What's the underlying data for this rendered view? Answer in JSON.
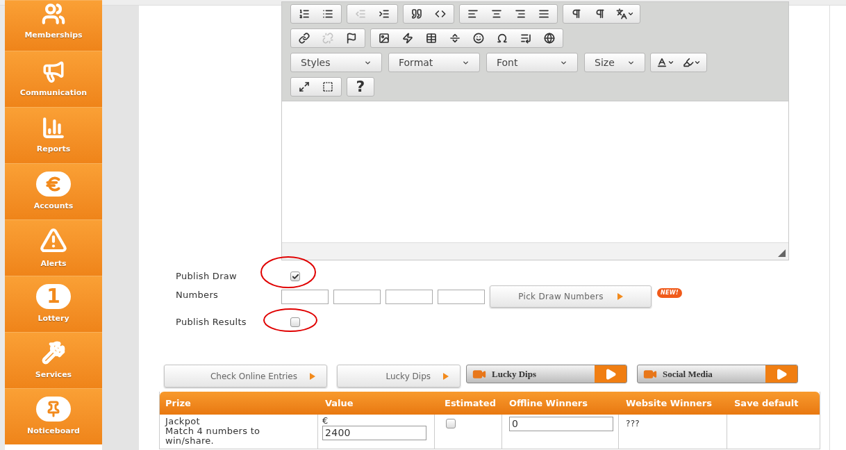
{
  "sidebar": {
    "items": [
      {
        "label": "Memberships",
        "kind": "people"
      },
      {
        "label": "Communication",
        "kind": "megaphone"
      },
      {
        "label": "Reports",
        "kind": "chart"
      },
      {
        "label": "Accounts",
        "kind": "euro"
      },
      {
        "label": "Alerts",
        "kind": "alert"
      },
      {
        "label": "Lottery",
        "kind": "number",
        "badge": "1"
      },
      {
        "label": "Services",
        "kind": "tools"
      },
      {
        "label": "Noticeboard",
        "kind": "pin"
      }
    ]
  },
  "editor": {
    "toolbar": [
      [
        {
          "buttons": [
            {
              "kind": "numbered-list",
              "disabled": false
            },
            {
              "kind": "bulleted-list",
              "disabled": false
            }
          ]
        },
        {
          "buttons": [
            {
              "kind": "outdent",
              "disabled": true
            },
            {
              "kind": "indent",
              "disabled": false
            }
          ]
        },
        {
          "buttons": [
            {
              "kind": "blockquote",
              "disabled": false
            },
            {
              "kind": "div",
              "disabled": false
            }
          ]
        },
        {
          "buttons": [
            {
              "kind": "align-left",
              "disabled": false
            },
            {
              "kind": "align-center",
              "disabled": false
            },
            {
              "kind": "align-right",
              "disabled": false
            },
            {
              "kind": "align-justify",
              "disabled": false
            }
          ]
        },
        {
          "buttons": [
            {
              "kind": "ltr",
              "disabled": false
            },
            {
              "kind": "rtl",
              "disabled": false
            },
            {
              "kind": "language",
              "disabled": false
            }
          ]
        }
      ],
      [
        {
          "buttons": [
            {
              "kind": "link",
              "disabled": false
            },
            {
              "kind": "unlink",
              "disabled": true
            },
            {
              "kind": "anchor",
              "disabled": false
            }
          ]
        },
        {
          "buttons": [
            {
              "kind": "image",
              "disabled": false
            },
            {
              "kind": "flash",
              "disabled": false
            },
            {
              "kind": "table",
              "disabled": false
            },
            {
              "kind": "rule",
              "disabled": false
            },
            {
              "kind": "smiley",
              "disabled": false
            },
            {
              "kind": "special-char",
              "disabled": false
            },
            {
              "kind": "page-break",
              "disabled": false
            },
            {
              "kind": "iframe",
              "disabled": false
            }
          ]
        }
      ],
      [
        {
          "combos": [
            "Styles",
            "Format",
            "Font",
            "Size"
          ]
        },
        {
          "buttons": [
            {
              "kind": "text-color",
              "disabled": false
            },
            {
              "kind": "bg-color",
              "disabled": false
            }
          ]
        }
      ],
      [
        {
          "buttons": [
            {
              "kind": "maximize",
              "disabled": false
            },
            {
              "kind": "show-blocks",
              "disabled": false
            }
          ]
        },
        {
          "buttons": [
            {
              "kind": "about",
              "disabled": false,
              "text": "?"
            }
          ]
        }
      ]
    ]
  },
  "publish_draw": {
    "label": "Publish Draw",
    "checked": true
  },
  "numbers": {
    "label": "Numbers",
    "button": "Pick Draw Numbers",
    "badge": "NEW!"
  },
  "publish_results": {
    "label": "Publish Results",
    "checked": false
  },
  "actions": [
    {
      "label": "Check Online Entries",
      "kind": "plain"
    },
    {
      "label": "Lucky Dips",
      "kind": "plain"
    },
    {
      "label": "Lucky Dips",
      "kind": "video"
    },
    {
      "label": "Social Media",
      "kind": "video"
    }
  ],
  "table": {
    "columns": [
      "Prize",
      "Value",
      "Estimated",
      "Offline Winners",
      "Website Winners",
      "Save default"
    ],
    "rows": [
      {
        "prize": "Jackpot",
        "description": "Match 4 numbers to win/share.",
        "currency": "€",
        "value": "2400",
        "estimated": false,
        "offline_winners": "0",
        "website_winners": "???"
      }
    ]
  }
}
